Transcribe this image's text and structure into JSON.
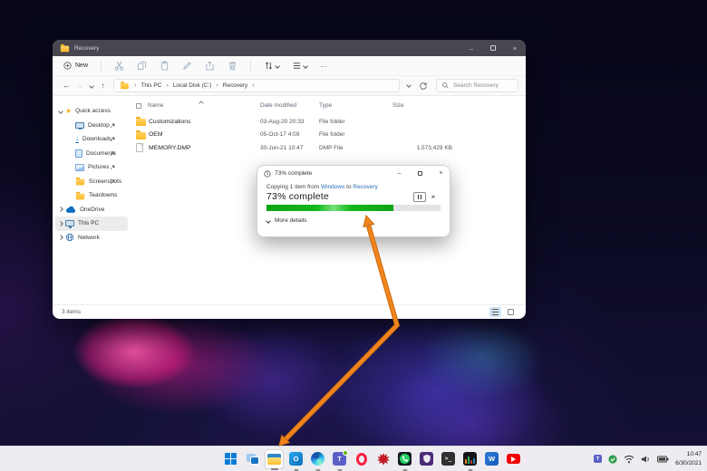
{
  "icons": {
    "back": "←",
    "forward": "→",
    "up": "↑",
    "minimize": "–",
    "close": "×",
    "more": "…",
    "crumb_sep": "›",
    "star": "★"
  },
  "explorer": {
    "title": "Recovery",
    "command_bar": {
      "new_label": "New"
    },
    "address": {
      "crumbs": [
        "This PC",
        "Local Disk (C:)",
        "Recovery"
      ]
    },
    "search": {
      "placeholder": "Search Recovery"
    },
    "columns": {
      "name": "Name",
      "date": "Date modified",
      "type": "Type",
      "size": "Size"
    },
    "files": [
      {
        "name": "Customizations",
        "date": "03-Aug-20 20:33",
        "type": "File folder",
        "size": "",
        "icon": "folder"
      },
      {
        "name": "OEM",
        "date": "05-Oct-17 4:09",
        "type": "File folder",
        "size": "",
        "icon": "folder"
      },
      {
        "name": "MEMORY.DMP",
        "date": "30-Jun-21 10:47",
        "type": "DMP File",
        "size": "1,573,429 KB",
        "icon": "dmp-file"
      }
    ],
    "sidebar": {
      "items": [
        {
          "label": "Quick access",
          "icon": "star"
        },
        {
          "label": "Desktop",
          "icon": "monitor",
          "pinned": true
        },
        {
          "label": "Downloads",
          "icon": "download-arrow",
          "pinned": true
        },
        {
          "label": "Documents",
          "icon": "document",
          "pinned": true
        },
        {
          "label": "Pictures",
          "icon": "picture",
          "pinned": true
        },
        {
          "label": "Screenshots",
          "icon": "folder",
          "pinned": true
        },
        {
          "label": "Teardowns",
          "icon": "folder",
          "pinned": false
        },
        {
          "label": "OneDrive",
          "icon": "cloud"
        },
        {
          "label": "This PC",
          "icon": "monitor",
          "selected": true
        },
        {
          "label": "Network",
          "icon": "globe"
        }
      ]
    },
    "status": {
      "count": "3 items"
    }
  },
  "dialog": {
    "title": "73% complete",
    "line_prefix": "Copying 1 item from ",
    "source": "Windows",
    "line_mid": " to ",
    "destination": "Recovery",
    "percent_label": "73% complete",
    "percent": 73,
    "more_details": "More details"
  },
  "taskbar": {
    "icons": [
      "start",
      "task-view",
      "file-explorer",
      "outlook",
      "edge",
      "teams",
      "opera",
      "red-app",
      "whatsapp",
      "security-shield",
      "terminal",
      "benchmark",
      "word",
      "youtube"
    ],
    "active_icon": "file-explorer",
    "tray": {
      "icons": [
        "teams",
        "shield-check",
        "wifi",
        "volume",
        "battery"
      ],
      "time": "10:47",
      "date": "6/30/2021"
    }
  },
  "colors": {
    "progress_green": "#13b81a",
    "arrow_orange": "#ee7f1d",
    "link_blue": "#2b6cb8",
    "folder_yellow": "#fcb826",
    "taskbar_bg": "#f5f4f7",
    "titlebar_dark": "#48464e",
    "selection_gray": "#ececec"
  }
}
